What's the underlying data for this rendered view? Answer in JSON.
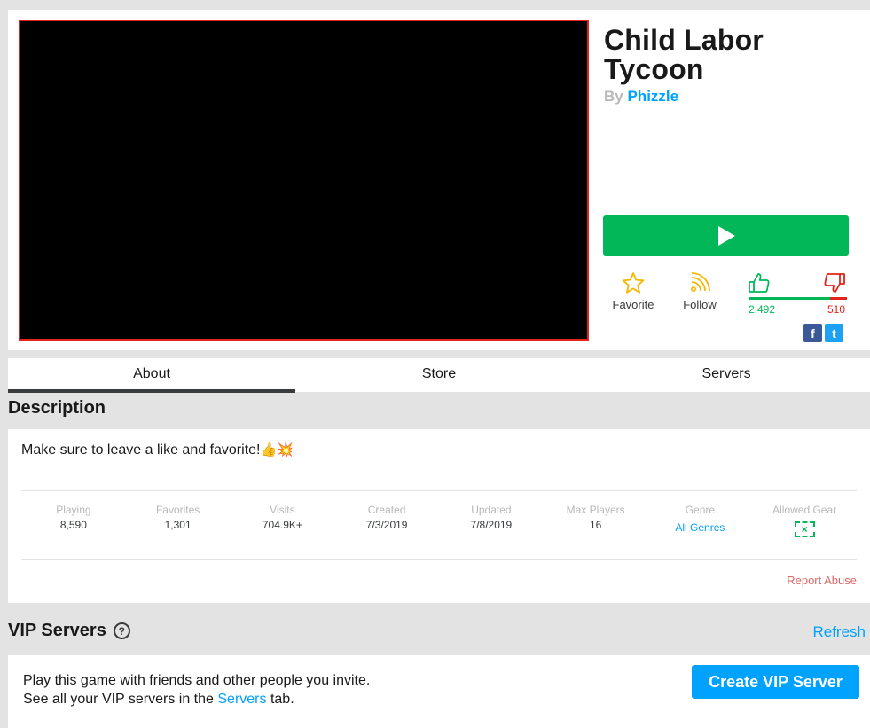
{
  "game": {
    "title": "Child Labor Tycoon",
    "by_prefix": "By",
    "creator": "Phizzle"
  },
  "actions": {
    "favorite_label": "Favorite",
    "follow_label": "Follow",
    "upvotes": "2,492",
    "downvotes": "510",
    "upvote_fraction": 0.83,
    "social": {
      "facebook_glyph": "f",
      "twitter_glyph": "t"
    }
  },
  "tabs": [
    {
      "label": "About",
      "active": true
    },
    {
      "label": "Store",
      "active": false
    },
    {
      "label": "Servers",
      "active": false
    }
  ],
  "description": {
    "heading": "Description",
    "text": "Make sure to leave a like and favorite!",
    "emojis": "👍💥"
  },
  "stats": [
    {
      "label": "Playing",
      "value": "8,590"
    },
    {
      "label": "Favorites",
      "value": "1,301"
    },
    {
      "label": "Visits",
      "value": "704.9K+"
    },
    {
      "label": "Created",
      "value": "7/3/2019"
    },
    {
      "label": "Updated",
      "value": "7/8/2019"
    },
    {
      "label": "Max Players",
      "value": "16"
    },
    {
      "label": "Genre",
      "value": "All Genres"
    },
    {
      "label": "Allowed Gear",
      "value": ""
    }
  ],
  "report_label": "Report Abuse",
  "vip": {
    "heading": "VIP Servers",
    "refresh_label": "Refresh",
    "line1": "Play this game with friends and other people you invite.",
    "line2_pre": "See all your VIP servers in the",
    "line2_link": "Servers",
    "line2_post": "tab.",
    "create_button": "Create VIP Server"
  },
  "colors": {
    "play_green": "#02b757",
    "link_blue": "#00a2ff",
    "thumb_border": "#e2231a",
    "downvote_red": "#e2231a"
  },
  "icons": {
    "play": "play-icon",
    "favorite": "star-icon",
    "follow": "rss-icon",
    "upvote": "thumbs-up-icon",
    "downvote": "thumbs-down-icon",
    "help": "question-circle-icon",
    "gear": "no-gear-icon"
  }
}
